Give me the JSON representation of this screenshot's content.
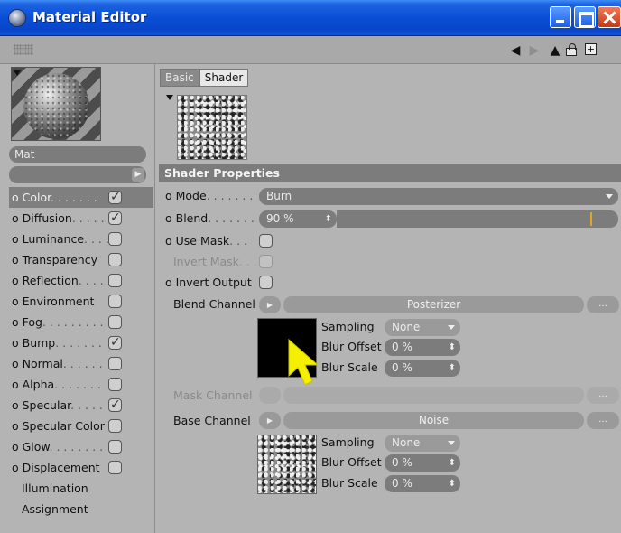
{
  "window": {
    "title": "Material Editor"
  },
  "left_panel": {
    "material_name": "Mat",
    "channels": [
      {
        "label": "Color",
        "dots": ". . . . . . .",
        "bullet": true,
        "checked": true,
        "selected": true
      },
      {
        "label": "Diffusion",
        "dots": ". . . . .",
        "bullet": true,
        "checked": true,
        "selected": false
      },
      {
        "label": "Luminance",
        "dots": ". . . .",
        "bullet": true,
        "checked": false,
        "selected": false
      },
      {
        "label": "Transparency",
        "dots": "",
        "bullet": true,
        "checked": false,
        "selected": false
      },
      {
        "label": "Reflection",
        "dots": ". . . . .",
        "bullet": true,
        "checked": false,
        "selected": false
      },
      {
        "label": "Environment",
        "dots": "",
        "bullet": true,
        "checked": false,
        "selected": false
      },
      {
        "label": "Fog",
        "dots": ". . . . . . . . .",
        "bullet": true,
        "checked": false,
        "selected": false
      },
      {
        "label": "Bump",
        "dots": ". . . . . . .",
        "bullet": true,
        "checked": true,
        "selected": false
      },
      {
        "label": "Normal",
        "dots": ". . . . . .",
        "bullet": true,
        "checked": false,
        "selected": false
      },
      {
        "label": "Alpha",
        "dots": ". . . . . . .",
        "bullet": true,
        "checked": false,
        "selected": false
      },
      {
        "label": "Specular",
        "dots": ". . . . .",
        "bullet": true,
        "checked": true,
        "selected": false
      },
      {
        "label": "Specular Color",
        "dots": "",
        "bullet": true,
        "checked": false,
        "selected": false
      },
      {
        "label": "Glow",
        "dots": ". . . . . . . .",
        "bullet": true,
        "checked": false,
        "selected": false
      },
      {
        "label": "Displacement",
        "dots": "",
        "bullet": true,
        "checked": false,
        "selected": false
      },
      {
        "label": "Illumination",
        "dots": "",
        "bullet": false,
        "checked": null,
        "selected": false
      },
      {
        "label": "Assignment",
        "dots": "",
        "bullet": false,
        "checked": null,
        "selected": false
      }
    ]
  },
  "tabs": [
    {
      "label": "Basic",
      "active": false
    },
    {
      "label": "Shader",
      "active": true
    }
  ],
  "shader_properties": {
    "header": "Shader Properties",
    "mode_label": "Mode",
    "mode_dots": ". . . . . . .",
    "mode_value": "Burn",
    "blend_label": "Blend",
    "blend_dots": ". . . . . . .",
    "blend_value": "90 %",
    "blend_fraction": 0.9,
    "use_mask_label": "Use Mask",
    "use_mask_dots": ". . .",
    "invert_mask_label": "Invert Mask",
    "invert_mask_dots": ". . .",
    "invert_output_label": "Invert Output",
    "blend_channel": {
      "label": "Blend Channel",
      "shader_name": "Posterizer",
      "more": "...",
      "sampling_label": "Sampling",
      "sampling_value": "None",
      "blur_offset_label": "Blur Offset",
      "blur_offset_value": "0 %",
      "blur_scale_label": "Blur Scale",
      "blur_scale_value": "0 %"
    },
    "mask_channel": {
      "label": "Mask Channel",
      "more": "..."
    },
    "base_channel": {
      "label": "Base Channel",
      "shader_name": "Noise",
      "more": "...",
      "sampling_label": "Sampling",
      "sampling_value": "None",
      "blur_offset_label": "Blur Offset",
      "blur_offset_value": "0 %",
      "blur_scale_label": "Blur Scale",
      "blur_scale_value": "0 %"
    }
  },
  "colors": {
    "titlebar": "#0a4ed6",
    "panel_bg": "#b4b4b4",
    "field_bg": "#7c7c7c",
    "slider_marker": "#e3a525",
    "cursor": "#f4f000"
  }
}
